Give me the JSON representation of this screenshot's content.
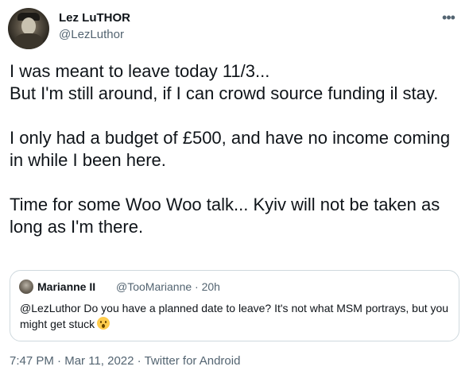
{
  "author": {
    "name": "Lez LuTHOR",
    "handle": "@LezLuthor"
  },
  "more_icon": "more-horizontal-icon",
  "tweet": {
    "text": "I was meant to leave today 11/3...\nBut I'm still around, if I can crowd source funding il stay.\n\nI only had a budget of £500, and have no income coming in while I been here.\n\nTime for some Woo Woo talk... Kyiv will not be taken as long as I'm there."
  },
  "quote": {
    "name": "Marianne II",
    "meta": "@TooMarianne · 20h",
    "text": "@LezLuthor Do you have a planned date to leave? It's  not what MSM portrays, but you might get stuck",
    "emoji_icon": "astonished-face-emoji"
  },
  "footer": {
    "time": "7:47 PM",
    "sep1": " · ",
    "date": "Mar 11, 2022",
    "sep2": " · ",
    "source": "Twitter for Android"
  }
}
